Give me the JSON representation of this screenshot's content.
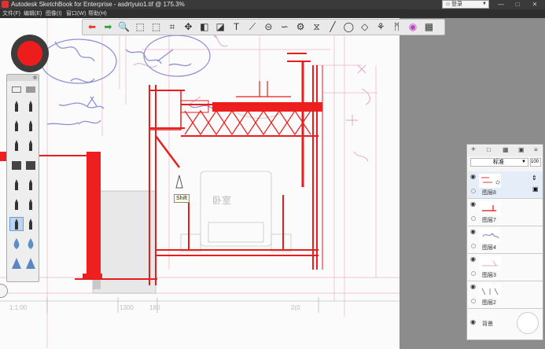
{
  "window": {
    "title": "Autodesk SketchBook for Enterprise - asdrtyuio1.tif @ 175.3%",
    "login_label": "登录",
    "min_glyph": "—",
    "max_glyph": "□",
    "close_glyph": "✕"
  },
  "menu": [
    "文件(F)",
    "编辑(E)",
    "图像(I)",
    "窗口(W)",
    "帮助(H)"
  ],
  "toolbar": {
    "tools": [
      {
        "name": "undo-icon",
        "glyph": "⬅"
      },
      {
        "name": "redo-icon",
        "glyph": "➡"
      },
      {
        "name": "zoom-icon",
        "glyph": "🔍"
      },
      {
        "name": "select-rect-icon",
        "glyph": "⬚"
      },
      {
        "name": "select-lasso-icon",
        "glyph": "⬚"
      },
      {
        "name": "crop-icon",
        "glyph": "⌗"
      },
      {
        "name": "move-icon",
        "glyph": "✥"
      },
      {
        "name": "distort-icon",
        "glyph": "◧"
      },
      {
        "name": "fill-icon",
        "glyph": "◪"
      },
      {
        "name": "text-icon",
        "glyph": "T"
      },
      {
        "name": "ruler-icon",
        "glyph": "⟋"
      },
      {
        "name": "ellipse-guide-icon",
        "glyph": "⊝"
      },
      {
        "name": "french-curve-icon",
        "glyph": "∽"
      },
      {
        "name": "perspective-icon",
        "glyph": "⚙"
      },
      {
        "name": "symmetry-icon",
        "glyph": "⧖"
      },
      {
        "name": "line-icon",
        "glyph": "╱"
      },
      {
        "name": "ellipse-icon",
        "glyph": "◯"
      },
      {
        "name": "shape-icon",
        "glyph": "◇"
      },
      {
        "name": "predictive-stroke-icon",
        "glyph": "⚘"
      },
      {
        "name": "brushes-icon",
        "glyph": "ᛗ"
      },
      {
        "name": "color-wheel-icon",
        "glyph": "◉"
      },
      {
        "name": "layers-icon",
        "glyph": "▦"
      }
    ]
  },
  "tooltip": "Shift",
  "layer_panel": {
    "blend_mode": "标准",
    "opacity": "100",
    "layers": [
      {
        "name": "图层8"
      },
      {
        "name": "图层7"
      },
      {
        "name": "图层4"
      },
      {
        "name": "图层3"
      },
      {
        "name": "图层2"
      }
    ],
    "background": "背景"
  },
  "canvas_labels": {
    "room_label": "卧室",
    "dim1": "1:1:00",
    "dim2": "1300",
    "dim3": "180",
    "dim4": "2(0"
  },
  "colors": {
    "accent_red": "#ee1d1d",
    "chrome_dark": "#2f2f2f",
    "canvas_bg": "#fbfbfb",
    "pencil_blue": "#7a7ec9",
    "pencil_pink": "#e7a9c4"
  }
}
